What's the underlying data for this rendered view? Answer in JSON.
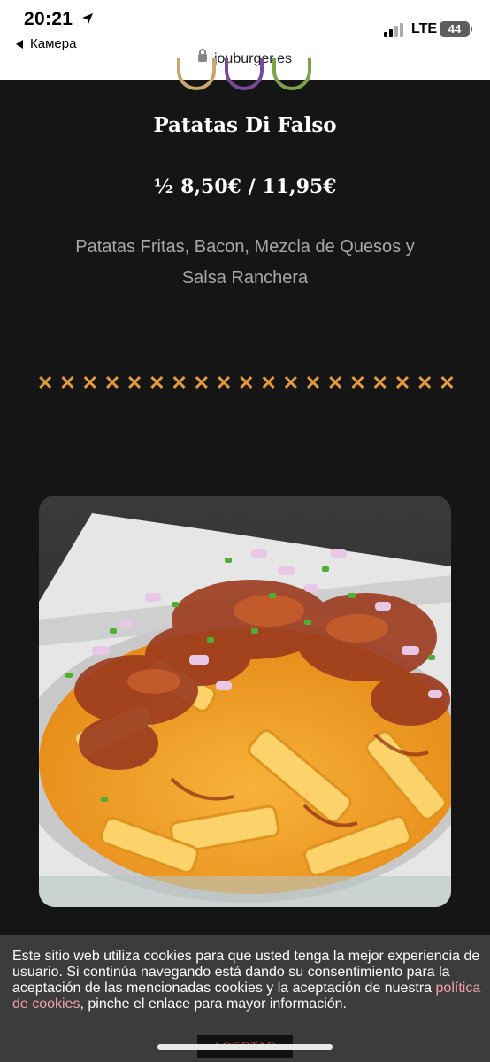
{
  "status": {
    "time": "20:21",
    "back_label": "Камера",
    "network": "LTE",
    "battery": "44"
  },
  "browser": {
    "url": "jouburger.es"
  },
  "product": {
    "title": "Patatas Di Falso",
    "price": "½ 8,50€ / 11,95€",
    "description": "Patatas Fritas, Bacon, Mezcla de Quesos y Salsa Ranchera",
    "divider": "✕✕✕✕✕✕✕✕✕✕✕✕✕✕✕✕✕✕✕✕"
  },
  "cookie": {
    "text_before_link": "Este sitio web utiliza cookies para que usted tenga la mejor experiencia de usuario. Si continúa navegando está dando su consentimiento para la aceptación de las mencionadas cookies y la aceptación de nuestra ",
    "link_label": "política de cookies",
    "text_after_link": ", pinche el enlace para mayor información.",
    "accept_label": "ACEPTAR"
  },
  "colors": {
    "background": "#151515",
    "accent_orange": "#e29a3c",
    "cookie_link": "#f0a0a8",
    "accept_text": "#e05a4a"
  }
}
